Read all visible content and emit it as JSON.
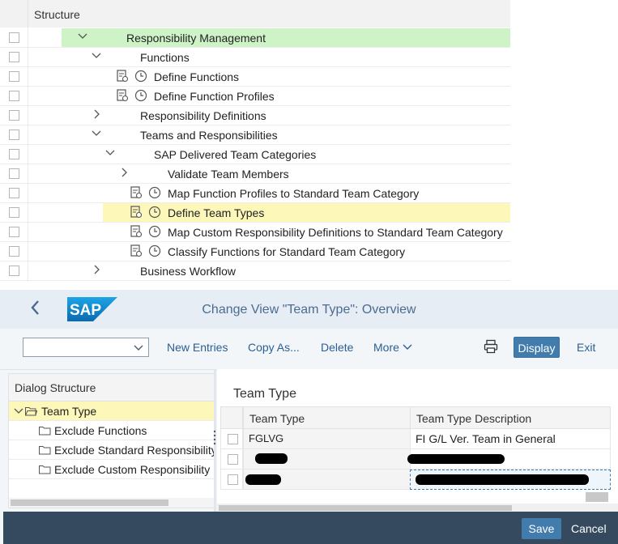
{
  "tree": {
    "header": "Structure",
    "rows": [
      {
        "label": "Responsibility Management"
      },
      {
        "label": "Functions"
      },
      {
        "label": "Define Functions"
      },
      {
        "label": "Define Function Profiles"
      },
      {
        "label": "Responsibility Definitions"
      },
      {
        "label": "Teams and Responsibilities"
      },
      {
        "label": "SAP Delivered Team Categories"
      },
      {
        "label": "Validate Team Members"
      },
      {
        "label": "Map Function Profiles to Standard Team Category"
      },
      {
        "label": "Define Team Types"
      },
      {
        "label": "Map Custom Responsibility Definitions to Standard Team Category"
      },
      {
        "label": "Classify Functions for Standard Team Category"
      },
      {
        "label": "Business Workflow"
      }
    ],
    "highlight_colors": {
      "green": "#cdf3c7",
      "yellow": "#fdf7b9"
    }
  },
  "shell": {
    "logo_text": "SAP",
    "title": "Change View \"Team Type\": Overview"
  },
  "toolbar": {
    "select_value": "",
    "new_entries": "New Entries",
    "copy_as": "Copy As...",
    "delete": "Delete",
    "more": "More",
    "display": "Display",
    "exit": "Exit"
  },
  "dialog": {
    "header": "Dialog Structure",
    "items": [
      {
        "label": "Team Type"
      },
      {
        "label": "Exclude Functions"
      },
      {
        "label": "Exclude Standard Responsibility"
      },
      {
        "label": "Exclude Custom Responsibility"
      }
    ]
  },
  "content": {
    "title": "Team Type",
    "columns": [
      "Team Type",
      "Team Type Description"
    ],
    "rows": [
      {
        "team_type": "FGLVG",
        "description": "FI G/L Ver. Team in General"
      }
    ]
  },
  "footer": {
    "save": "Save",
    "cancel": "Cancel"
  },
  "colors": {
    "accent": "#427cac",
    "shellbar": "#e6edf4",
    "footer": "#354a5f"
  }
}
